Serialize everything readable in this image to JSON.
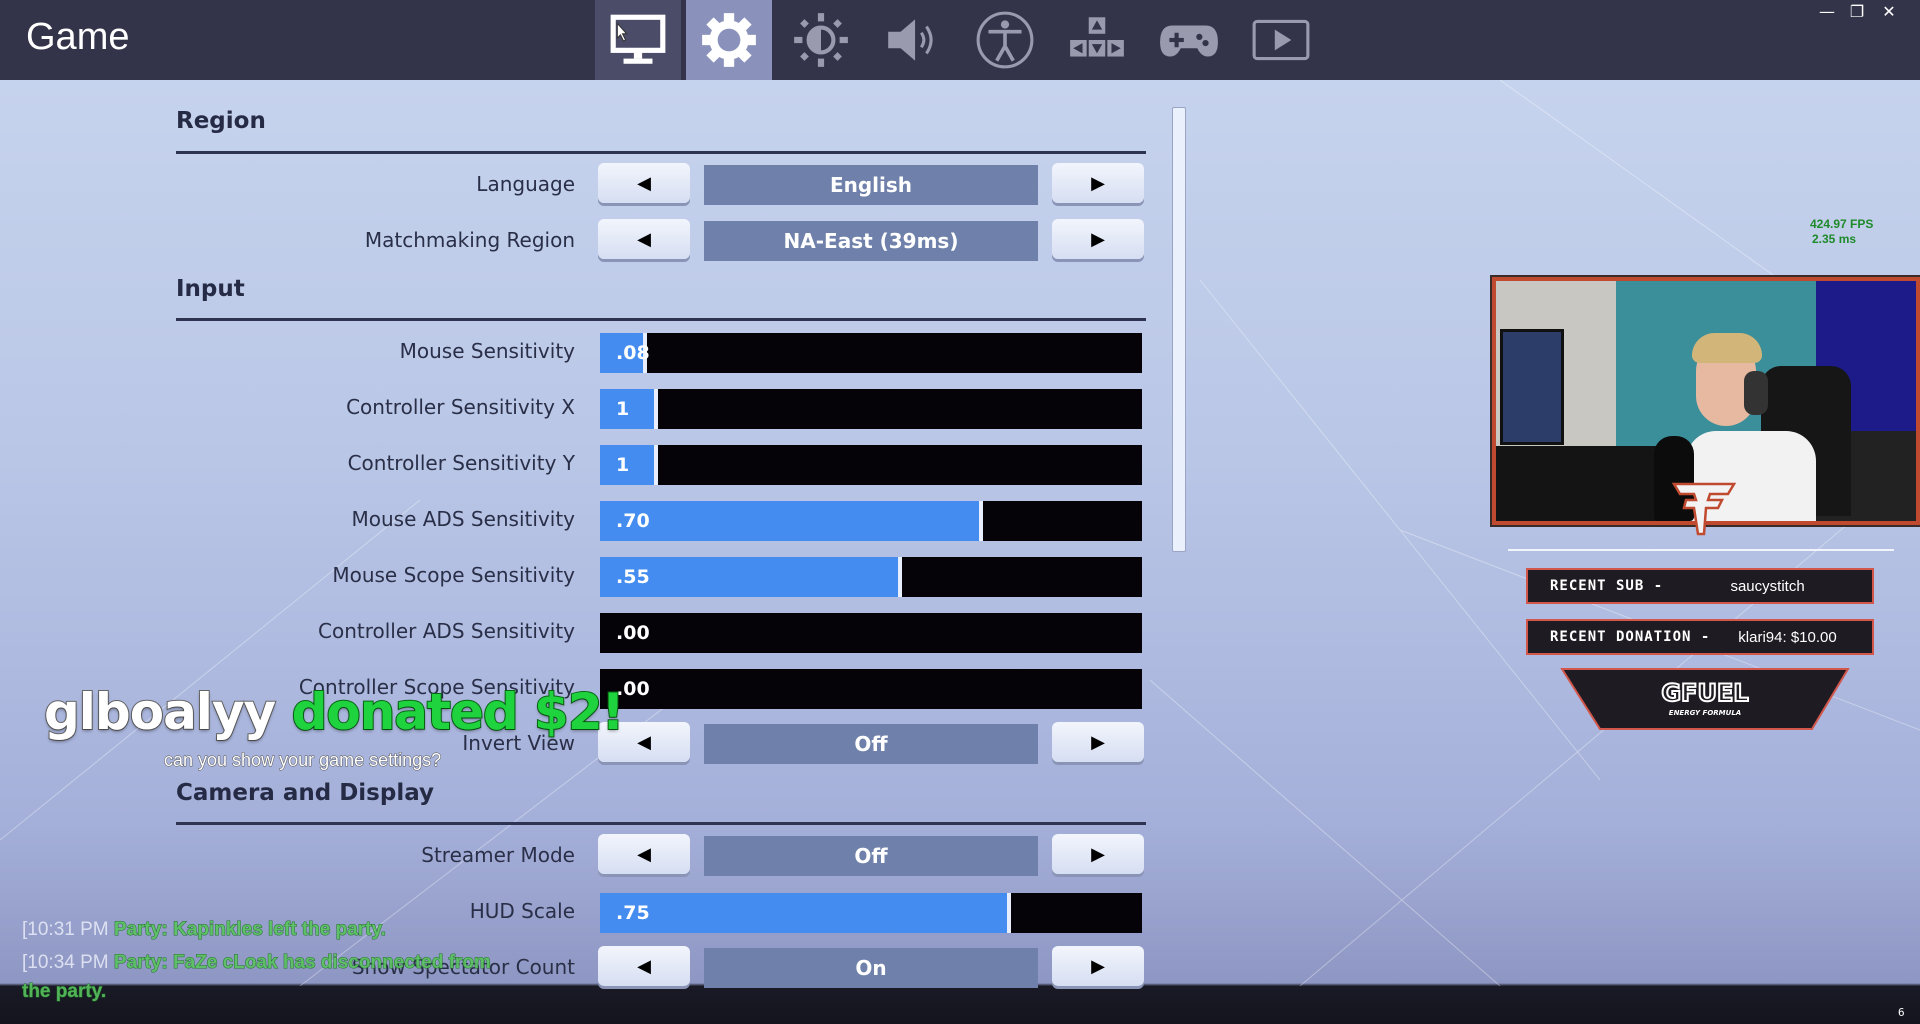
{
  "window": {
    "title": "Game",
    "controls": {
      "minimize": "—",
      "restore": "❐",
      "close": "✕"
    }
  },
  "tabs": [
    {
      "name": "video",
      "icon": "monitor-icon",
      "state": "hover"
    },
    {
      "name": "game",
      "icon": "gear-icon",
      "state": "active"
    },
    {
      "name": "brightness",
      "icon": "brightness-icon",
      "state": ""
    },
    {
      "name": "audio",
      "icon": "speaker-icon",
      "state": ""
    },
    {
      "name": "accessibility",
      "icon": "accessibility-icon",
      "state": ""
    },
    {
      "name": "input",
      "icon": "arrow-keys-icon",
      "state": ""
    },
    {
      "name": "controller",
      "icon": "gamepad-icon",
      "state": ""
    },
    {
      "name": "replay",
      "icon": "play-icon",
      "state": ""
    }
  ],
  "sections": {
    "region": "Region",
    "input": "Input",
    "camera": "Camera and Display"
  },
  "settings": {
    "language": {
      "label": "Language",
      "value": "English"
    },
    "matchmaking_region": {
      "label": "Matchmaking Region",
      "value": "NA-East (39ms)"
    },
    "mouse_sensitivity": {
      "label": "Mouse Sensitivity",
      "value": ".08",
      "fraction": 0.08
    },
    "controller_sensitivity_x": {
      "label": "Controller Sensitivity X",
      "value": "1",
      "fraction": 0.1
    },
    "controller_sensitivity_y": {
      "label": "Controller Sensitivity Y",
      "value": "1",
      "fraction": 0.1
    },
    "mouse_ads_sensitivity": {
      "label": "Mouse ADS Sensitivity",
      "value": ".70",
      "fraction": 0.7
    },
    "mouse_scope_sensitivity": {
      "label": "Mouse Scope Sensitivity",
      "value": ".55",
      "fraction": 0.55
    },
    "controller_ads_sensitivity": {
      "label": "Controller ADS Sensitivity",
      "value": ".00",
      "fraction": 0
    },
    "controller_scope_sensitivity": {
      "label": "Controller Scope Sensitivity",
      "value": ".00",
      "fraction": 0
    },
    "invert_view": {
      "label": "Invert View",
      "value": "Off"
    },
    "streamer_mode": {
      "label": "Streamer Mode",
      "value": "Off"
    },
    "hud_scale": {
      "label": "HUD Scale",
      "value": ".75",
      "fraction": 0.75
    },
    "show_spectator_count": {
      "label": "Show Spectator Count",
      "value": "On"
    }
  },
  "arrows": {
    "left": "◀",
    "right": "▶"
  },
  "overlay": {
    "fps": "424.97 FPS",
    "frame_time": "2.35 ms",
    "recent_sub_label": "RECENT SUB -",
    "recent_sub_value": "saucystitch",
    "recent_donation_label": "RECENT DONATION -",
    "recent_donation_value": "klari94: $10.00",
    "sponsor": "GFUEL",
    "sponsor_tagline": "ENERGY FORMULA",
    "donation_alert": {
      "name": "glboalyy",
      "action": "donated $2!",
      "message": "can you show your game settings?"
    },
    "chat": [
      {
        "time": "[10:31 PM",
        "message": "Party:  Kapinkles left the party."
      },
      {
        "time": "[10:34 PM",
        "message": "Party:  FaZe cLoak has disconnected from"
      },
      {
        "time": "",
        "message": "the party."
      }
    ],
    "corner_number": "6"
  },
  "colors": {
    "accent_fill": "#458cf0",
    "tab_active": "#8a92bb",
    "topbar": "#33334a",
    "donation_green": "#1fd33e",
    "overlay_red": "#d2564a"
  }
}
